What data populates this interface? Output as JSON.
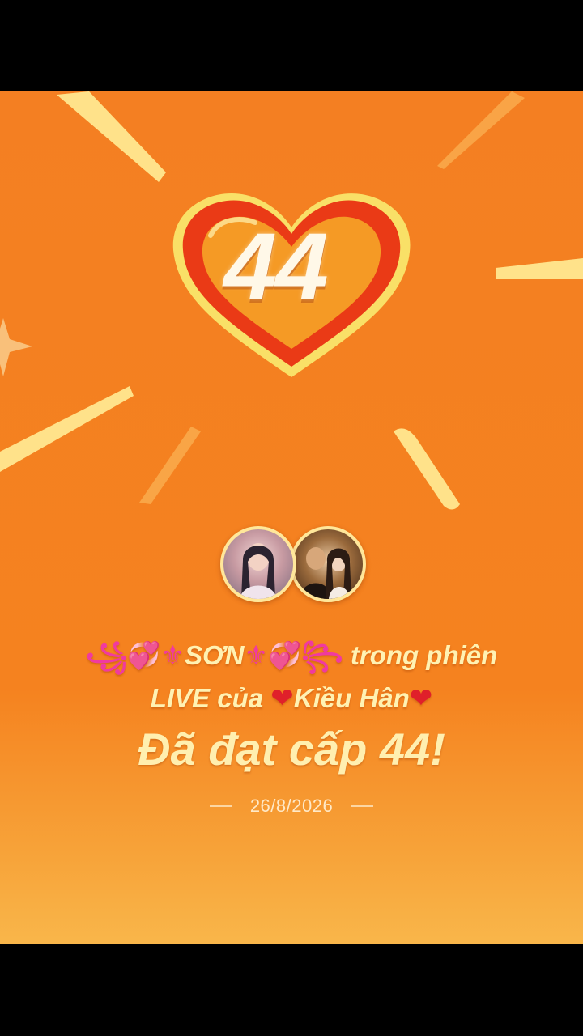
{
  "badge": {
    "level": "44"
  },
  "message": {
    "user_name_deco_left": "꧁💞⚜",
    "user_name": "SƠN",
    "user_name_deco_right": "⚜💞꧂",
    "in_session": "trong phiên",
    "live_of": "LIVE của",
    "host_name_heart_left": "❤",
    "host_name": "Kiều Hân",
    "host_name_heart_right": "❤",
    "achievement": "Đã đạt cấp 44!"
  },
  "date": "26/8/2026",
  "colors": {
    "background": "#f5821f",
    "text_primary": "#fff2b3",
    "heart_red": "#e0202a"
  },
  "icons": [
    "heart-level-badge-icon",
    "sparkle-icon",
    "red-heart-icon"
  ]
}
